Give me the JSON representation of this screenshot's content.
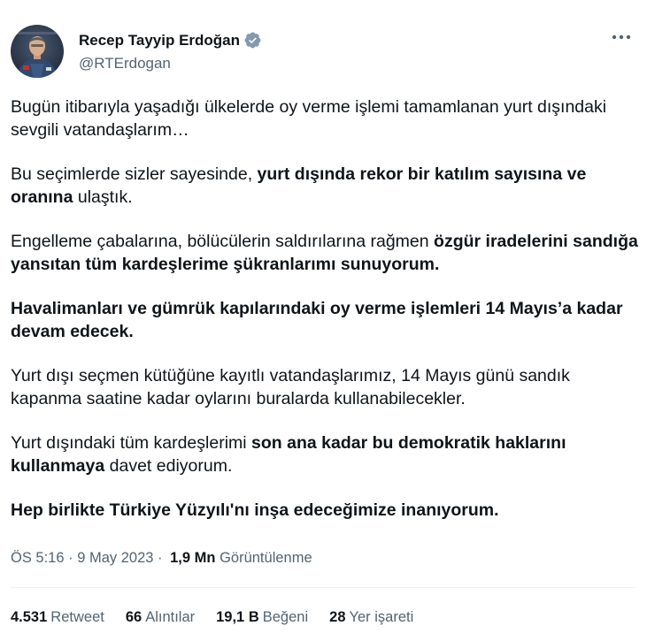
{
  "author": {
    "display_name": "Recep Tayyip Erdoğan",
    "handle": "@RTErdogan",
    "verified_icon": "verified-badge-icon",
    "avatar_icon": "profile-photo"
  },
  "colors": {
    "verified": "#829aab",
    "secondary_text": "#536471",
    "primary_text": "#0f1419"
  },
  "tweet": {
    "p1": "Bugün itibarıyla yaşadığı ülkelerde oy verme işlemi tamamlanan yurt dışındaki sevgili vatandaşlarım…",
    "p2": {
      "a": "Bu seçimlerde sizler sayesinde, ",
      "b": "yurt dışında rekor bir katılım sayısına ve oranına",
      "c": " ulaştık."
    },
    "p3": {
      "a": "Engelleme çabalarına, bölücülerin saldırılarına rağmen ",
      "b": "özgür iradelerini sandığa yansıtan tüm kardeşlerime şükranlarımı sunuyorum."
    },
    "p4": "Havalimanları ve gümrük kapılarındaki oy verme işlemleri 14 Mayıs’a kadar devam edecek.",
    "p5": "Yurt dışı seçmen kütüğüne kayıtlı vatandaşlarımız, 14 Mayıs günü sandık kapanma saatine kadar oylarını buralarda kullanabilecekler.",
    "p6": {
      "a": "Yurt dışındaki tüm kardeşlerimi ",
      "b": "son ana kadar bu demokratik haklarını kullanmaya",
      "c": " davet ediyorum."
    },
    "p7": "Hep birlikte Türkiye Yüzyılı'nı inşa edeceğimize inanıyorum."
  },
  "meta": {
    "time": "ÖS 5:16",
    "sep1": " · ",
    "date": "9 May 2023",
    "sep2": " · ",
    "views_count": "1,9 Mn",
    "views_label": " Görüntülenme"
  },
  "stats": [
    {
      "num": "4.531",
      "label": "Retweet"
    },
    {
      "num": "66",
      "label": "Alıntılar"
    },
    {
      "num": "19,1 B",
      "label": "Beğeni"
    },
    {
      "num": "28",
      "label": "Yer işareti"
    }
  ]
}
